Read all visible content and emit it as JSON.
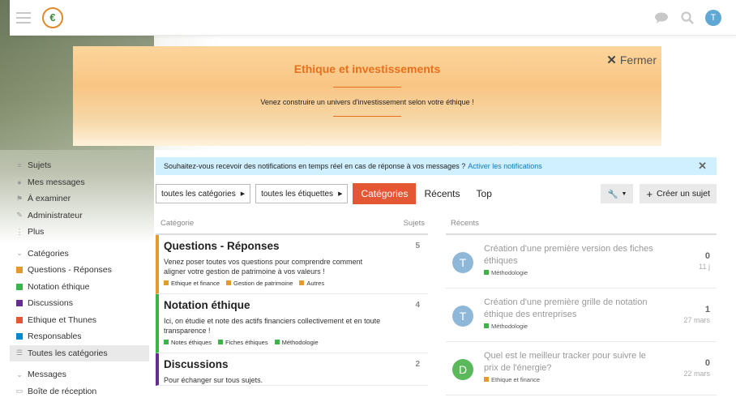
{
  "header": {
    "logo_text": "€",
    "avatar_letter": "T",
    "icons": [
      "menu-icon",
      "chat-icon",
      "search-icon"
    ]
  },
  "banner": {
    "title": "Ethique et investissements",
    "subtitle": "Venez construire un univers d'investissement selon votre éthique !",
    "close_label": "Fermer"
  },
  "sidebar": {
    "items": [
      {
        "icon": "≡",
        "label": "Sujets"
      },
      {
        "icon": "👤",
        "label": "Mes messages"
      },
      {
        "icon": "⚑",
        "label": "À examiner"
      },
      {
        "icon": "🔧",
        "label": "Administrateur"
      },
      {
        "icon": "⋮",
        "label": "Plus"
      }
    ],
    "categories_header": "Catégories",
    "categories": [
      {
        "label": "Questions - Réponses",
        "color": "#e59a30"
      },
      {
        "label": "Notation éthique",
        "color": "#3ab54a"
      },
      {
        "label": "Discussions",
        "color": "#652d90"
      },
      {
        "label": "Ethique et Thunes",
        "color": "#e45735"
      },
      {
        "label": "Responsables",
        "color": "#0088cc"
      }
    ],
    "all_categories": "Toutes les catégories",
    "messages_header": "Messages",
    "inbox": "Boîte de réception"
  },
  "notification": {
    "text": "Souhaitez-vous recevoir des notifications en temps réel en cas de réponse à vos messages ?",
    "link": "Activer les notifications"
  },
  "toolbar": {
    "categories_dropdown": "toutes les catégories",
    "tags_dropdown": "toutes les étiquettes",
    "nav": [
      "Catégories",
      "Récents",
      "Top"
    ],
    "active_nav": "Catégories",
    "create_topic": "Créer un sujet"
  },
  "categories_table": {
    "col_category": "Catégorie",
    "col_topics": "Sujets",
    "rows": [
      {
        "name": "Questions - Réponses",
        "color": "#e59a30",
        "count": "5",
        "description": "Venez poser toutes vos questions pour comprendre comment aligner votre gestion de patrimoine à vos valeurs !",
        "subcategories": [
          {
            "label": "Ethique et finance",
            "color": "#e59a30"
          },
          {
            "label": "Gestion de patrimoine",
            "color": "#e59a30"
          },
          {
            "label": "Autres",
            "color": "#e59a30"
          }
        ]
      },
      {
        "name": "Notation éthique",
        "color": "#3ab54a",
        "count": "4",
        "description": "Ici, on étudie et note des actifs financiers collectivement et en toute transparence !",
        "subcategories": [
          {
            "label": "Notes éthiques",
            "color": "#3ab54a"
          },
          {
            "label": "Fiches éthiques",
            "color": "#3ab54a"
          },
          {
            "label": "Méthodologie",
            "color": "#3ab54a"
          }
        ]
      },
      {
        "name": "Discussions",
        "color": "#652d90",
        "count": "2",
        "description": "Pour échanger sur tous sujets.",
        "subcategories": []
      }
    ]
  },
  "recent": {
    "header": "Récents",
    "topics": [
      {
        "avatar": "T",
        "avatar_color": "#8fb8d8",
        "title": "Création d'une première version des fiches éthiques",
        "category": "Méthodologie",
        "cat_color": "#3ab54a",
        "replies": "0",
        "date": "11 j"
      },
      {
        "avatar": "T",
        "avatar_color": "#8fb8d8",
        "title": "Création d'une première grille de notation éthique des entreprises",
        "category": "Méthodologie",
        "cat_color": "#3ab54a",
        "replies": "1",
        "date": "27 mars"
      },
      {
        "avatar": "D",
        "avatar_color": "#5bb85b",
        "title": "Quel est le meilleur tracker pour suivre le prix de l'énergie?",
        "category": "Ethique et finance",
        "cat_color": "#e59a30",
        "replies": "0",
        "date": "22 mars"
      }
    ]
  }
}
